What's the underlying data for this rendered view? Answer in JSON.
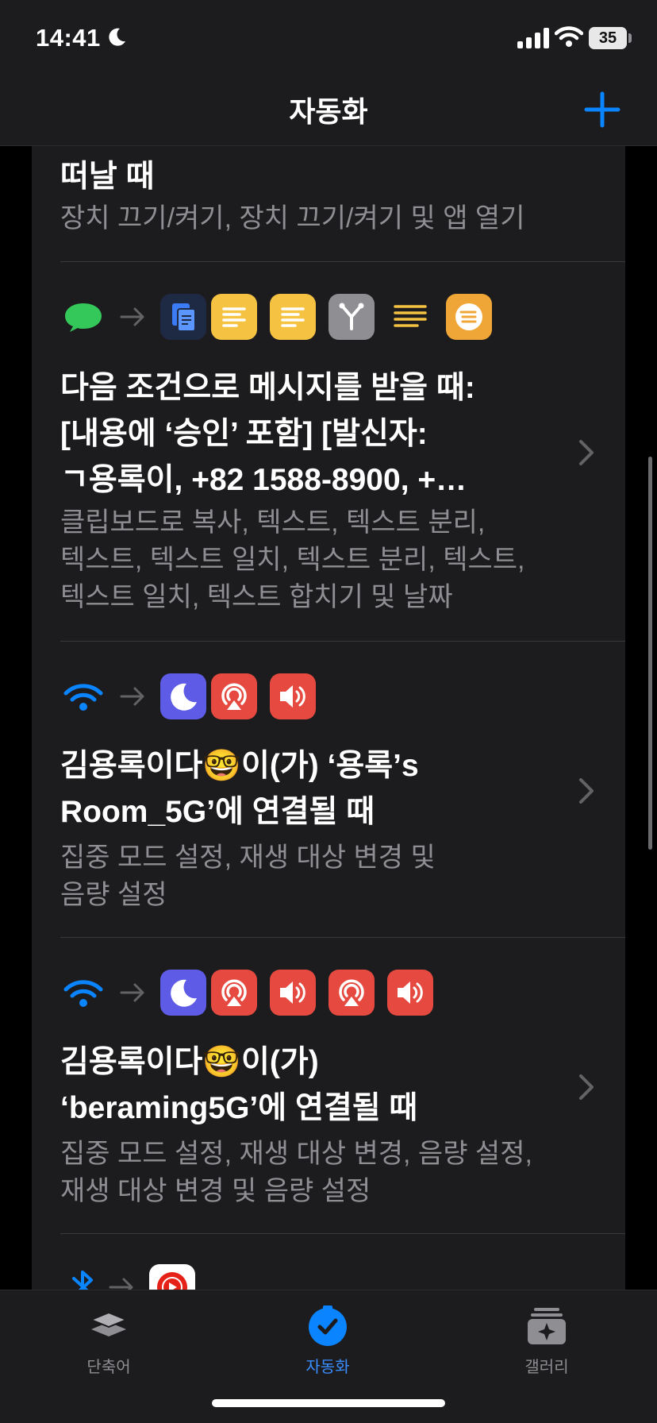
{
  "status_bar": {
    "time": "14:41",
    "battery": "35"
  },
  "nav": {
    "title": "자동화"
  },
  "automations": [
    {
      "title": "떠날 때",
      "subtitle": "장치 끄기/켜기, 장치 끄기/켜기 및 앱 열기"
    },
    {
      "title_lines": [
        "다음 조건으로 메시지를 받을 때:",
        "[내용에 ‘승인’ 포함] [발신자:",
        "ㄱ용록이, +82 1588-8900, +…"
      ],
      "subtitle_lines": [
        "클립보드로 복사, 텍스트, 텍스트 분리,",
        "텍스트, 텍스트 일치, 텍스트 분리, 텍스트,",
        "텍스트 일치, 텍스트 합치기 및 날짜"
      ],
      "icons": [
        "message-icon",
        "clipboard-icon",
        "text-icon",
        "text-icon",
        "split-text-icon",
        "match-text-icon",
        "combine-text-icon"
      ]
    },
    {
      "title_lines": [
        "김용록이다🤓이(가) ‘용록’s",
        "Room_5G’에 연결될 때"
      ],
      "subtitle_lines": [
        "집중 모드 설정, 재생 대상 변경 및",
        "음량 설정"
      ],
      "icons": [
        "wifi-icon",
        "focus-moon-icon",
        "airplay-icon",
        "volume-icon"
      ]
    },
    {
      "title_lines": [
        "김용록이다🤓이(가)",
        "‘beraming5G’에 연결될 때"
      ],
      "subtitle_lines": [
        "집중 모드 설정, 재생 대상 변경, 음량 설정,",
        "재생 대상 변경 및 음량 설정"
      ],
      "icons": [
        "wifi-icon",
        "focus-moon-icon",
        "airplay-icon",
        "volume-icon",
        "airplay-icon",
        "volume-icon"
      ]
    },
    {
      "icons": [
        "bluetooth-icon",
        "youtube-music-icon"
      ]
    }
  ],
  "tabs": [
    {
      "label": "단축어",
      "icon": "shortcuts-layers-icon",
      "active": false
    },
    {
      "label": "자동화",
      "icon": "automation-check-icon",
      "active": true
    },
    {
      "label": "갤러리",
      "icon": "gallery-sparkle-icon",
      "active": false
    }
  ],
  "colors": {
    "accent": "#0a84ff",
    "background": "#000000",
    "card": "#1c1c1e",
    "secondary_text": "#8e8e93",
    "message_green": "#34c759",
    "text_yellow": "#f5c242",
    "focus_purple": "#5e5ce6",
    "audio_red": "#e5493f"
  }
}
